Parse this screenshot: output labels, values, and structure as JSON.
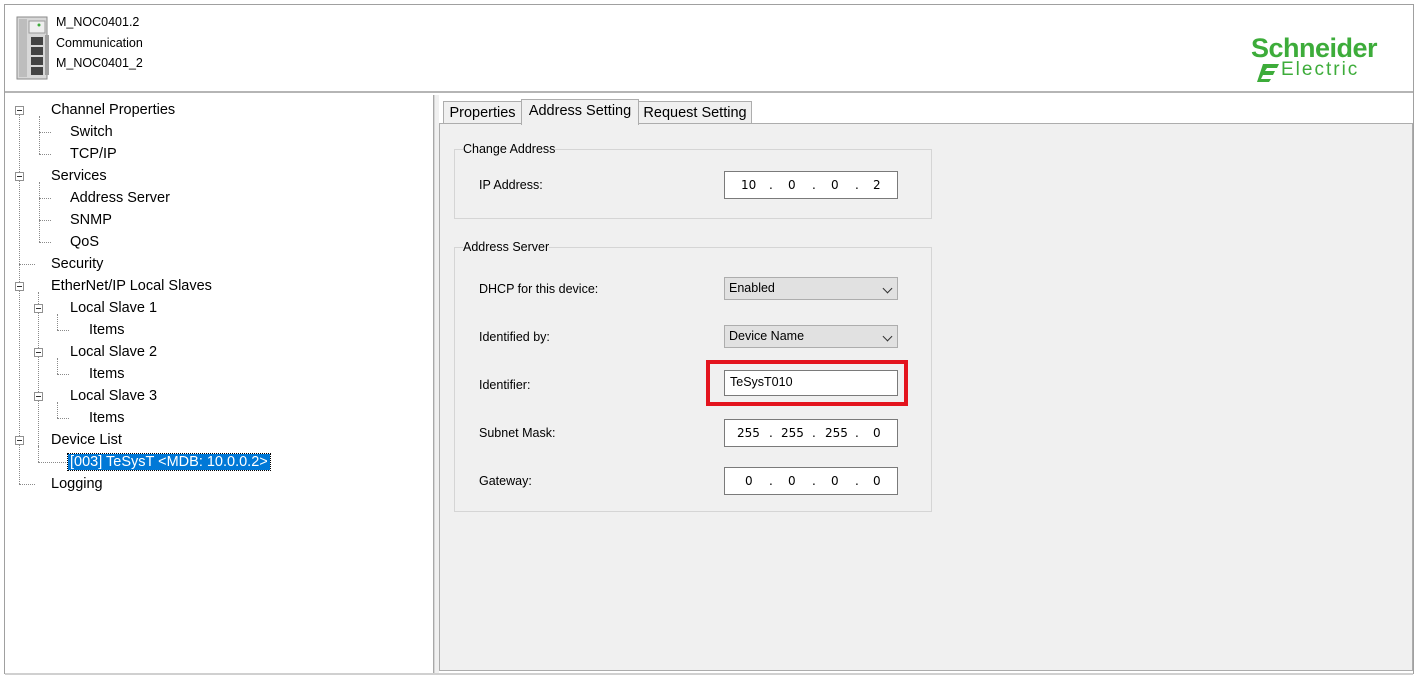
{
  "header": {
    "module_name": "M_NOC0401.2",
    "category": "Communication",
    "instance_name": "M_NOC0401_2",
    "logo_top": "Schneider",
    "logo_bottom": "Electric",
    "logo_color": "#3dac3a"
  },
  "tree": {
    "items": [
      {
        "label": "Channel Properties"
      },
      {
        "label": "Switch"
      },
      {
        "label": "TCP/IP"
      },
      {
        "label": "Services"
      },
      {
        "label": "Address Server"
      },
      {
        "label": "SNMP"
      },
      {
        "label": "QoS"
      },
      {
        "label": "Security"
      },
      {
        "label": "EtherNet/IP Local Slaves"
      },
      {
        "label": "Local Slave 1"
      },
      {
        "label": "Items"
      },
      {
        "label": "Local Slave 2"
      },
      {
        "label": "Items"
      },
      {
        "label": "Local Slave 3"
      },
      {
        "label": "Items"
      },
      {
        "label": "Device List"
      },
      {
        "label": "[003] TeSysT <MDB: 10.0.0.2>"
      },
      {
        "label": "Logging"
      }
    ],
    "selected_color": "#0078d7"
  },
  "tabs": [
    {
      "label": "Properties"
    },
    {
      "label": "Address Setting"
    },
    {
      "label": "Request Setting"
    }
  ],
  "change_address": {
    "title": "Change Address",
    "ip_label": "IP Address:",
    "ip": [
      "10",
      "0",
      "0",
      "2"
    ]
  },
  "address_server": {
    "title": "Address Server",
    "dhcp_label": "DHCP for this device:",
    "dhcp_value": "Enabled",
    "identified_label": "Identified by:",
    "identified_value": "Device Name",
    "identifier_label": "Identifier:",
    "identifier_value": "TeSysT010",
    "subnet_label": "Subnet Mask:",
    "subnet": [
      "255",
      "255",
      "255",
      "0"
    ],
    "gateway_label": "Gateway:",
    "gateway": [
      "0",
      "0",
      "0",
      "0"
    ],
    "highlight_color": "#e3141e"
  }
}
